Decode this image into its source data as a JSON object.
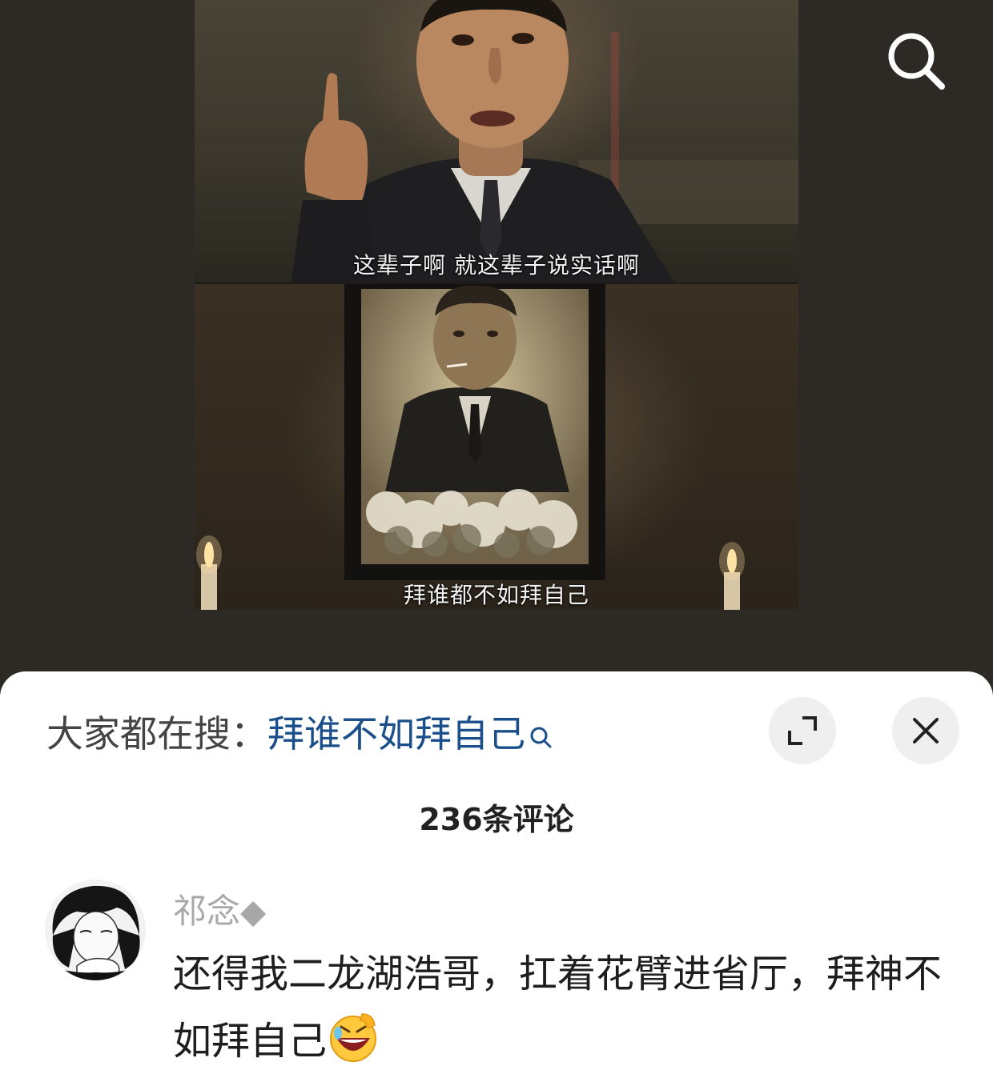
{
  "video": {
    "subtitle_top": "这辈子啊 就这辈子说实话啊",
    "subtitle_bottom": "拜谁都不如拜自己"
  },
  "sheet": {
    "search_prefix": "大家都在搜：",
    "search_term": "拜谁不如拜自己",
    "comment_count": "236条评论"
  },
  "comments": [
    {
      "username": "祁念◆",
      "text": "还得我二龙湖浩哥，扛着花臂进省厅，拜神不如拜自己"
    }
  ],
  "icons": {
    "video_search": "search-icon",
    "expand": "expand-icon",
    "close": "close-icon",
    "search_hint": "search-small-icon",
    "emoji": "laughing-emoji-icon"
  },
  "colors": {
    "search_term": "#1a4f8c",
    "sheet_bg": "#ffffff",
    "video_bg": "#2d2924"
  }
}
